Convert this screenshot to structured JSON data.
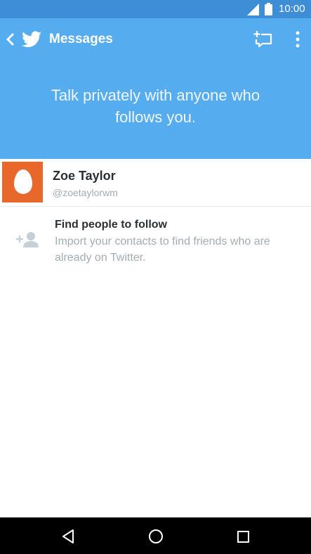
{
  "status_bar": {
    "time": "10:00"
  },
  "app_bar": {
    "title": "Messages",
    "tagline": "Talk privately with anyone who follows you."
  },
  "contact": {
    "name": "Zoe Taylor",
    "handle": "@zoetaylorwm"
  },
  "find_people": {
    "title": "Find people to follow",
    "description": "Import your contacts to find friends who are already on Twitter."
  },
  "colors": {
    "status_bar": "#3d8ed6",
    "header": "#55acee",
    "avatar": "#e8682c",
    "nav_bar": "#000000"
  },
  "icons": {
    "back": "chevron-left-icon",
    "brand": "twitter-bird-icon",
    "compose": "new-message-icon",
    "more": "more-vert-icon",
    "find": "add-person-icon"
  }
}
